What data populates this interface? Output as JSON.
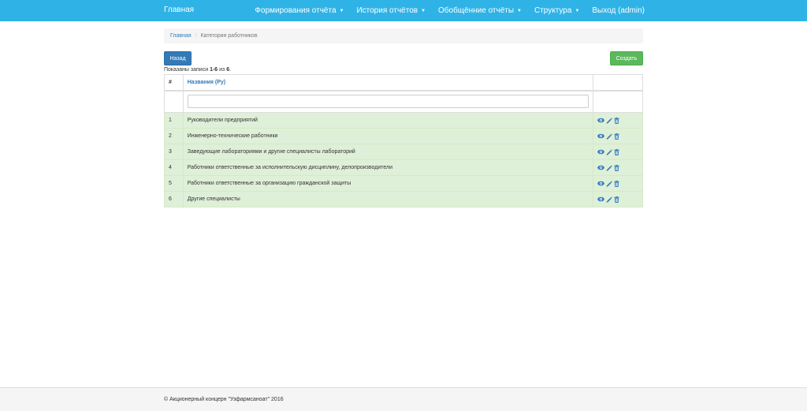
{
  "navbar": {
    "brand": "Главная",
    "items": [
      {
        "label": "Формирования отчёта",
        "has_caret": true
      },
      {
        "label": "История отчётов",
        "has_caret": true
      },
      {
        "label": "Обобщённие отчёты",
        "has_caret": true
      },
      {
        "label": "Структура",
        "has_caret": true
      },
      {
        "label": "Выход (admin)",
        "has_caret": false
      }
    ],
    "caret_glyph": "▼",
    "color": "#2fb3e6"
  },
  "breadcrumb": {
    "home": "Главная",
    "separator": "/",
    "current": "Категория работников"
  },
  "buttons": {
    "back": "Назад",
    "create": "Создать"
  },
  "summary": {
    "prefix": "Показаны записи ",
    "range": "1-6",
    "middle": " из ",
    "total": "6",
    "suffix": "."
  },
  "table": {
    "headers": {
      "num": "#",
      "name": "Названия (Ру)",
      "actions": ""
    },
    "filter_value": "",
    "rows": [
      {
        "num": "1",
        "name": "Руководители предприятий"
      },
      {
        "num": "2",
        "name": "Инженерно-технические работники"
      },
      {
        "num": "3",
        "name": "Заведующие лабораториями и другие специалисты лабораторий"
      },
      {
        "num": "4",
        "name": "Работники ответственные за исполнительскую дисциплину, делопроизводители"
      },
      {
        "num": "5",
        "name": "Работники ответственные за организацию гражданской защиты"
      },
      {
        "num": "6",
        "name": "Другие специалисты"
      }
    ],
    "row_icons": [
      "eye-icon",
      "pencil-icon",
      "trash-icon"
    ],
    "row_color": "#dff0d8"
  },
  "footer": {
    "text": "© Акционерный концерн \"Узфармсаноат\" 2016"
  }
}
